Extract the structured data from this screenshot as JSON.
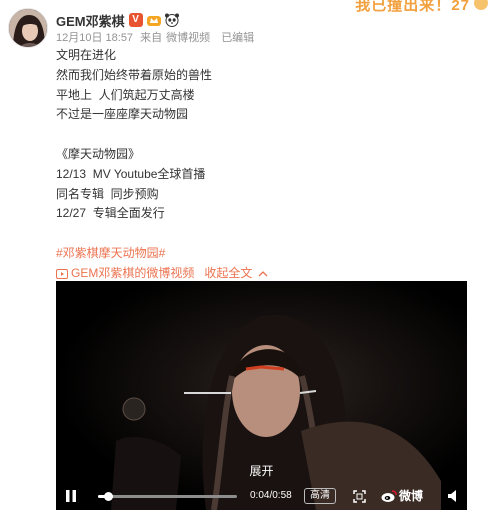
{
  "banner": {
    "text": "我已撞出来！",
    "number": "27"
  },
  "post": {
    "username": "GEM邓紫棋",
    "verified_badge": "V",
    "badge_icons": [
      "crown-icon",
      "panda-icon"
    ],
    "date": "12月10日 18:57",
    "source_prefix": "来自",
    "source": "微博视频",
    "edited": "已编辑",
    "lines": [
      "文明在进化",
      "然而我们始终带着原始的兽性",
      "平地上  人们筑起万丈高楼",
      "不过是一座座摩天动物园",
      "",
      "《摩天动物园》",
      "12/13  MV Youtube全球首播",
      "同名专辑  同步预购",
      "12/27  专辑全面发行"
    ],
    "hashtag": "#邓紫棋摩天动物园#",
    "video_link": "GEM邓紫棋的微博视频",
    "collapse": "收起全文"
  },
  "player": {
    "overlay_label": "展开",
    "progress": 0.07,
    "time": "0:04/0:58",
    "quality": "高清",
    "logo_text": "微博"
  },
  "colors": {
    "accent": "#eb7350",
    "badge": "#e8542f",
    "meta": "#939393"
  }
}
